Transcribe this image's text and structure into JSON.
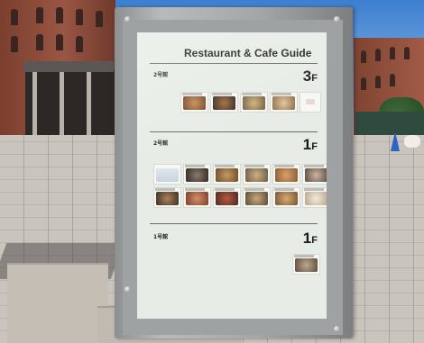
{
  "sign": {
    "title": "Restaurant & Cafe Guide",
    "sections": [
      {
        "label": "2号館",
        "floor_num": "3",
        "floor_unit": "F"
      },
      {
        "label": "2号館",
        "floor_num": "1",
        "floor_unit": "F"
      },
      {
        "label": "1号館",
        "floor_num": "1",
        "floor_unit": "F"
      }
    ]
  },
  "colors": {
    "panel": "#e7ece6",
    "frame": "#a4a6a8",
    "brick": "#9a5644",
    "sky": "#3d7fd0",
    "pavement": "#c9c4bd"
  }
}
